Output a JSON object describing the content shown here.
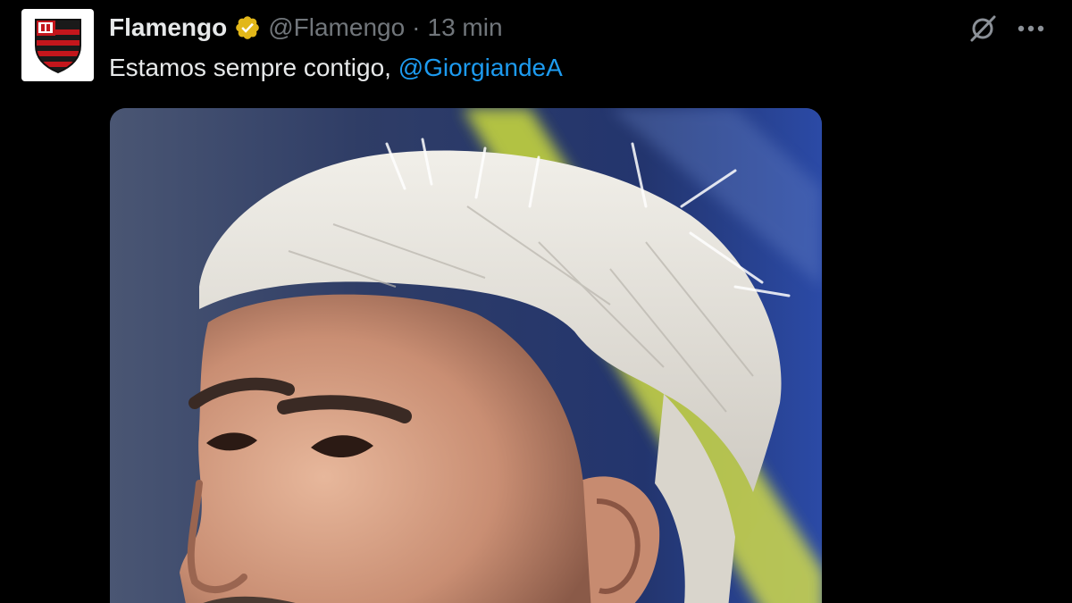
{
  "tweet": {
    "author_name": "Flamengo",
    "handle": "@Flamengo",
    "separator": "·",
    "time": "13 min",
    "text_prefix": "Estamos sempre contigo, ",
    "mention": "@GiorgiandeA"
  },
  "icons": {
    "avatar": "flamengo-crest-icon",
    "verified": "verified-gold-badge-icon",
    "grok": "grok-icon",
    "more": "more-dots-icon"
  },
  "colors": {
    "background": "#000000",
    "text": "#e7e9ea",
    "secondary_text": "#71767b",
    "link": "#1d9bf0",
    "verified_gold": "#e2b719",
    "flamengo_red": "#c4161c"
  }
}
